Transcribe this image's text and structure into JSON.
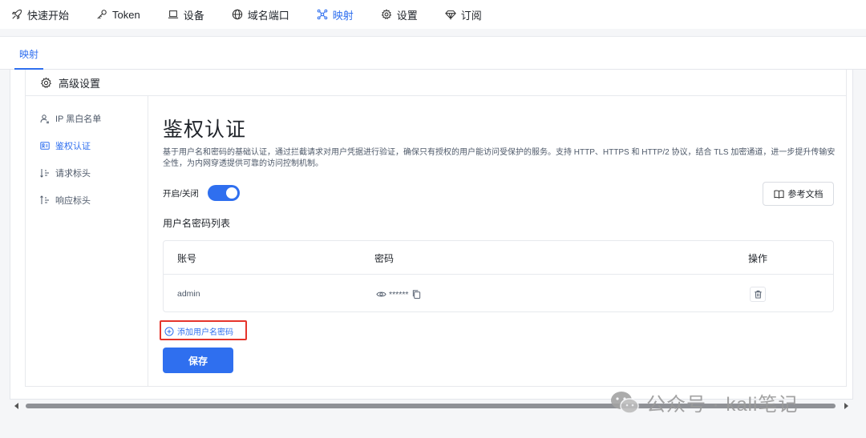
{
  "topnav": {
    "items": [
      {
        "label": "快速开始",
        "icon": "rocket-icon"
      },
      {
        "label": "Token",
        "icon": "key-icon"
      },
      {
        "label": "设备",
        "icon": "laptop-icon"
      },
      {
        "label": "域名端口",
        "icon": "globe-icon"
      },
      {
        "label": "映射",
        "icon": "network-icon",
        "active": true
      },
      {
        "label": "设置",
        "icon": "gear-icon"
      },
      {
        "label": "订阅",
        "icon": "diamond-icon"
      }
    ]
  },
  "subtabs": {
    "active": "映射"
  },
  "card": {
    "header": "高级设置"
  },
  "sidebar": {
    "items": [
      {
        "label": "IP 黑白名单",
        "icon": "user-list-icon"
      },
      {
        "label": "鉴权认证",
        "icon": "id-card-icon",
        "active": true
      },
      {
        "label": "请求标头",
        "icon": "request-header-icon"
      },
      {
        "label": "响应标头",
        "icon": "response-header-icon"
      }
    ]
  },
  "main": {
    "title": "鉴权认证",
    "description": "基于用户名和密码的基础认证，通过拦截请求对用户凭据进行验证，确保只有授权的用户能访问受保护的服务。支持 HTTP、HTTPS 和 HTTP/2 协议，结合 TLS 加密通道，进一步提升传输安全性，为内网穿透提供可靠的访问控制机制。",
    "toggle_label": "开启/关闭",
    "toggle_on": true,
    "doc_button": "参考文档",
    "list_title": "用户名密码列表",
    "table": {
      "headers": [
        "账号",
        "密码",
        "操作"
      ],
      "rows": [
        {
          "account": "admin",
          "password": "******"
        }
      ]
    },
    "add_link": "添加用户名密码",
    "save_button": "保存"
  },
  "watermark": "公众号 · kali笔记",
  "colors": {
    "accent": "#2f6fef",
    "highlight": "#e5342b"
  }
}
